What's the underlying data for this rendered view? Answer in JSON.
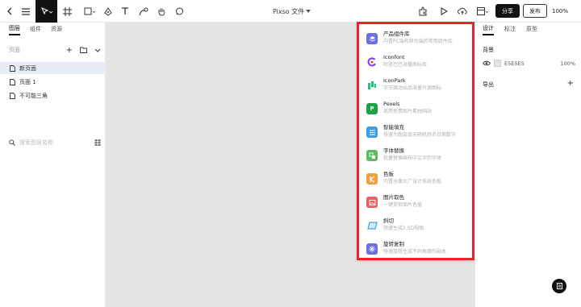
{
  "toolbar": {
    "doc_title": "Pixso 文件",
    "share_label": "分享",
    "publish_label": "发布",
    "zoom": "100%"
  },
  "left_panel": {
    "tabs": [
      {
        "label": "图层"
      },
      {
        "label": "组件"
      },
      {
        "label": "资源"
      }
    ],
    "pages_label": "页面",
    "pages": [
      {
        "label": "新页面"
      },
      {
        "label": "页面 1"
      },
      {
        "label": "不可能三角"
      }
    ],
    "search_placeholder": "搜索图层名称"
  },
  "plugins": [
    {
      "name": "产品组件库",
      "desc": "内置PC端和移动端的常用组件库",
      "icon": "layers-icon",
      "color": "#6b6fe0"
    },
    {
      "name": "Iconfont",
      "desc": "阿里巴巴海量图标库",
      "icon": "iconfont-logo-icon",
      "color": "#7b3ff2"
    },
    {
      "name": "IconPark",
      "desc": "字节跳动出品海量开源图标",
      "icon": "iconpark-logo-icon",
      "color": "#20c27a"
    },
    {
      "name": "Pexels",
      "desc": "商用免费图片素材网站",
      "icon": "pexels-logo-icon",
      "color": "#1aa34a"
    },
    {
      "name": "智能填充",
      "desc": "快速为图层填充随机姓名日期数字",
      "icon": "fill-icon",
      "color": "#3b9ce8"
    },
    {
      "name": "字体替换",
      "desc": "批量替换画布中文字的字体",
      "icon": "font-replace-icon",
      "color": "#5dbb5d"
    },
    {
      "name": "色板",
      "desc": "内置全面大厂设计系统色板",
      "icon": "palette-icon",
      "color": "#f0a040"
    },
    {
      "name": "图片取色",
      "desc": "一键提取图片色值",
      "icon": "image-color-icon",
      "color": "#e86060"
    },
    {
      "name": "斜切",
      "desc": "快速生成2.5D视图",
      "icon": "skew-icon",
      "color": "#3aa6e8"
    },
    {
      "name": "旋转复制",
      "desc": "快速旋转生成不同角度的副本",
      "icon": "rotate-copy-icon",
      "color": "#6b6fe0"
    }
  ],
  "right_panel": {
    "tabs": [
      {
        "label": "设计"
      },
      {
        "label": "标注"
      },
      {
        "label": "原型"
      }
    ],
    "background_label": "背景",
    "bg_hex": "E5E5E5",
    "bg_opacity": "100%",
    "export_label": "导出"
  }
}
